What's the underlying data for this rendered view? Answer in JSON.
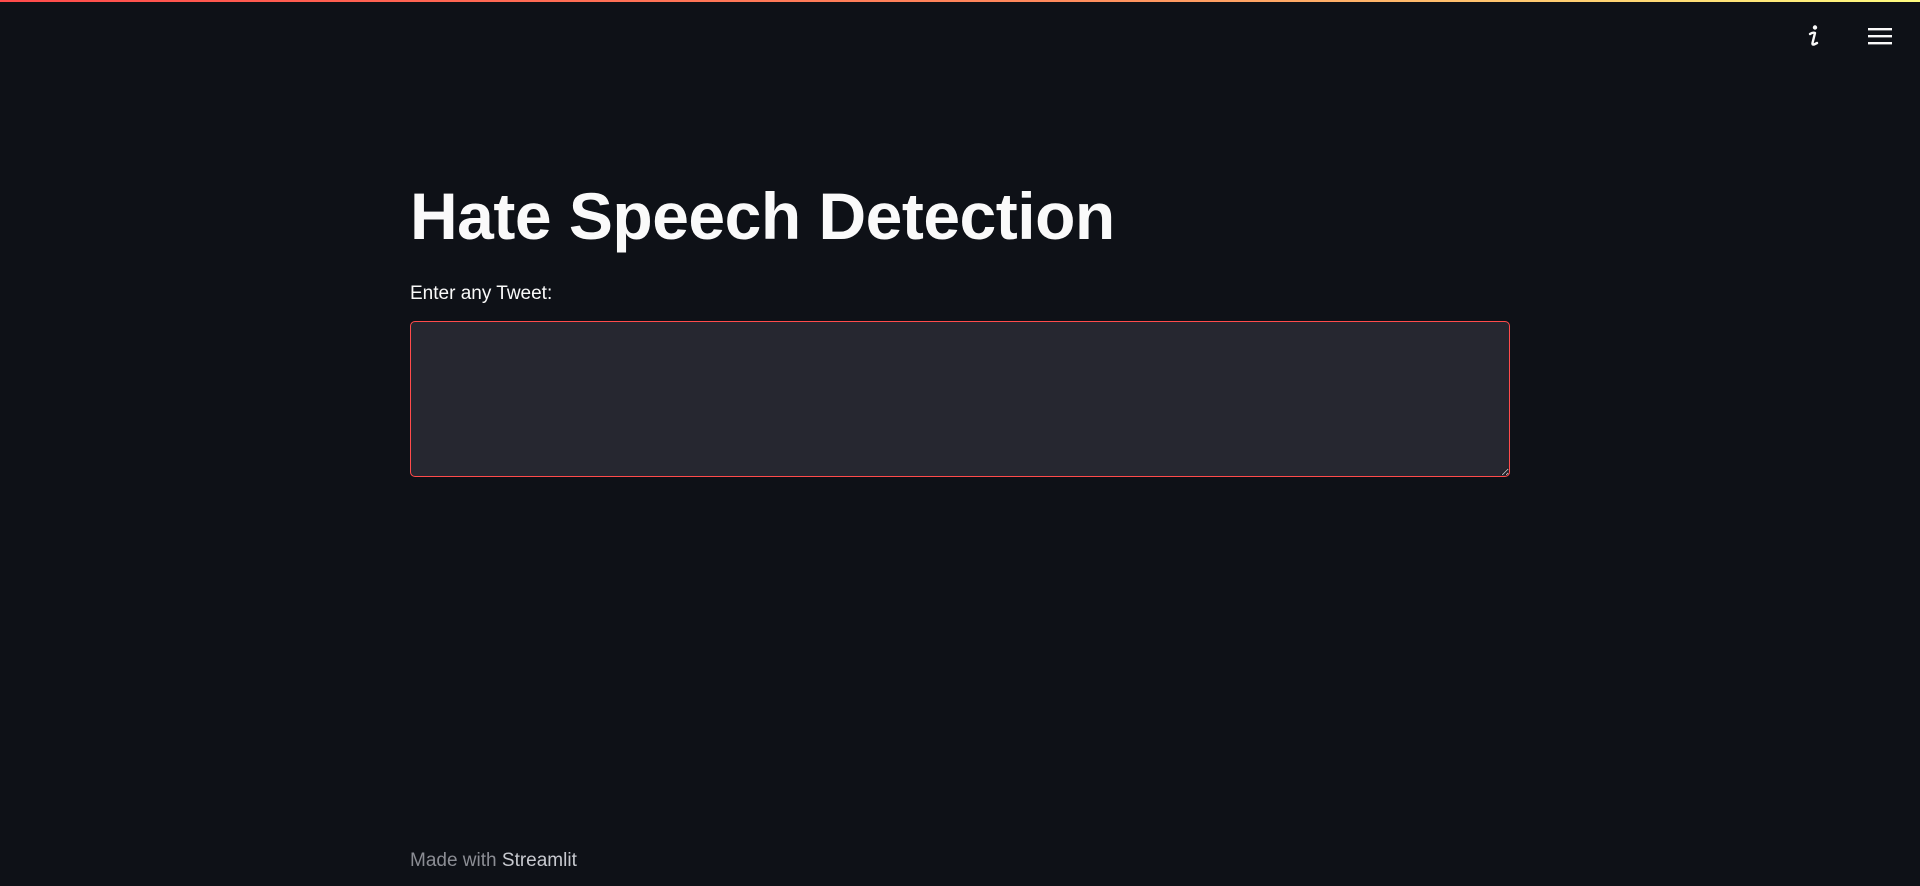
{
  "app": {
    "title": "Hate Speech Detection"
  },
  "toolbar": {
    "icons": [
      "info-icon",
      "hamburger-menu-icon"
    ]
  },
  "form": {
    "label": "Enter any Tweet:",
    "value": "",
    "placeholder": ""
  },
  "footer": {
    "prefix": "Made with",
    "brand": "Streamlit"
  },
  "colors": {
    "background": "#0e1117",
    "input_background": "#262730",
    "accent": "#ff4b4b",
    "text": "#fafafa"
  }
}
